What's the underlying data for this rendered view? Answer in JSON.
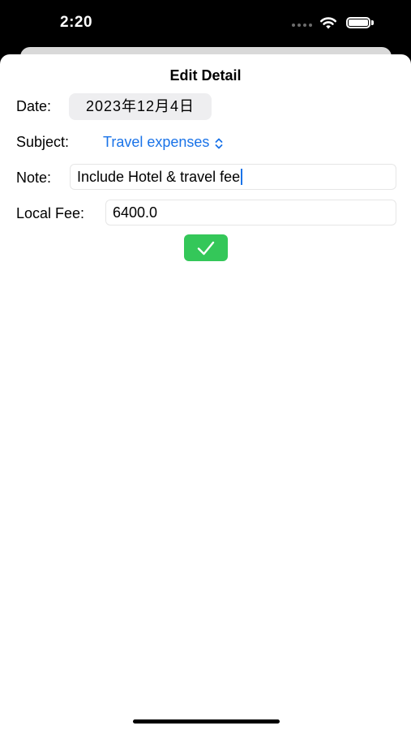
{
  "status_bar": {
    "time": "2:20",
    "icons": [
      "cellular-signal-icon",
      "wifi-icon",
      "battery-icon"
    ]
  },
  "sheet": {
    "title": "Edit Detail"
  },
  "form": {
    "date_label": "Date:",
    "date_value": "2023年12月4日",
    "subject_label": "Subject:",
    "subject_value": "Travel expenses",
    "note_label": "Note:",
    "note_value": "Include Hotel & travel fee",
    "fee_label": "Local Fee:",
    "fee_value": "6400.0"
  },
  "confirm": {
    "icon": "checkmark-icon",
    "color": "#34c759"
  },
  "colors": {
    "accent": "#1a73e8",
    "confirm": "#34c759",
    "date_pill_bg": "#eeeef0"
  }
}
